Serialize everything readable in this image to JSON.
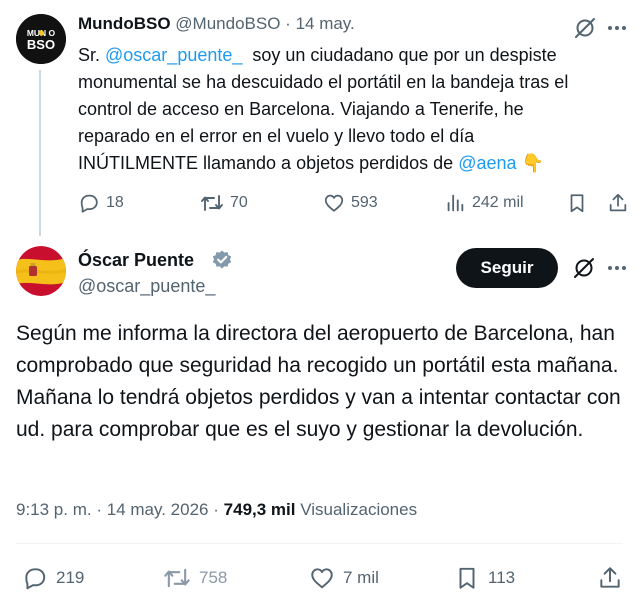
{
  "tweet1": {
    "avatar_text": "MUNDO BSO",
    "name": "MundoBSO",
    "handle": "@MundoBSO",
    "sep": "·",
    "date": "14 may.",
    "text_before": "Sr. ",
    "mention1": "@oscar_puente_",
    "text_middle": "  soy un ciudadano que por un despiste monumental se ha descuidado el portátil en la bandeja tras el control de acceso en Barcelona. Viajando a Tenerife, he reparado en el error en el vuelo y llevo todo el día INÚTILMENTE llamando a objetos perdidos de ",
    "mention2": "@aena",
    "emoji": "👇",
    "replies": "18",
    "reposts": "70",
    "likes": "593",
    "views": "242 mil"
  },
  "tweet2": {
    "name": "Óscar Puente",
    "handle": "@oscar_puente_",
    "follow_label": "Seguir",
    "body": "Según me informa la directora del aeropuerto de Barcelona, han comprobado que seguridad ha recogido un portátil esta mañana. Mañana lo tendrá objetos perdidos y van a intentar contactar con ud. para comprobar que es el suyo y gestionar la devolución.",
    "time": "9:13 p. m.",
    "sep1": "·",
    "date": "14 may. 2026",
    "sep2": "·",
    "views_count": "749,3 mil",
    "views_label": "Visualizaciones",
    "replies": "219",
    "reposts": "758",
    "likes": "7 mil",
    "bookmarks": "113"
  },
  "colors": {
    "accent": "#1d9bf0",
    "text": "#0f1419",
    "muted": "#536471",
    "button_bg": "#0f1419",
    "verified": "#829aab"
  },
  "icons": [
    "grok-icon",
    "more-icon",
    "reply-icon",
    "repost-icon",
    "like-icon",
    "views-icon",
    "bookmark-icon",
    "share-icon",
    "verified-badge-icon"
  ]
}
